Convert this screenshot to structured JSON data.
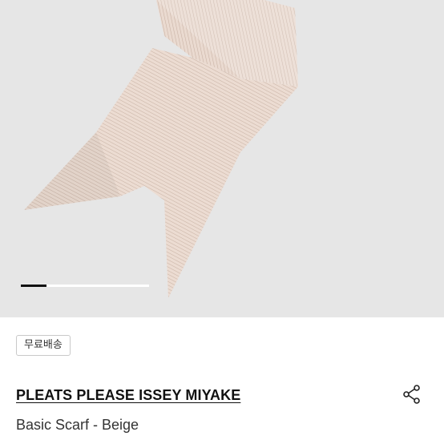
{
  "product_image": {
    "subject": "scarf",
    "carousel": {
      "current_index": 1,
      "progress_fraction": 0.2
    }
  },
  "badge": {
    "label": "무료배송"
  },
  "product": {
    "brand": "PLEATS PLEASE ISSEY MIYAKE",
    "name": "Basic Scarf - Beige"
  },
  "actions": {
    "share_icon": "share-icon"
  },
  "colors": {
    "hero_background": "#e6e6e6",
    "scarf": "#e9d9d0",
    "accent_text": "#111111"
  }
}
